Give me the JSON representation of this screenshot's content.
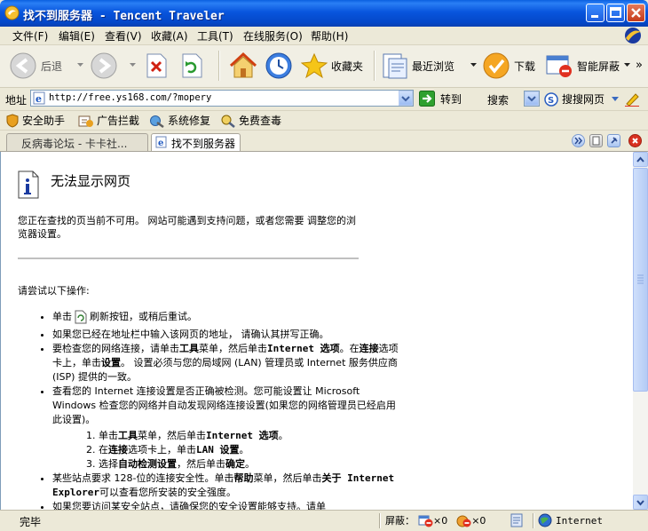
{
  "window": {
    "title": "找不到服务器 - Tencent Traveler"
  },
  "menu": [
    "文件(F)",
    "编辑(E)",
    "查看(V)",
    "收藏(A)",
    "工具(T)",
    "在线服务(O)",
    "帮助(H)"
  ],
  "toolbar": {
    "back": "后退",
    "favorites": "收藏夹",
    "recent": "最近浏览",
    "download": "下载",
    "smart_block": "智能屏蔽",
    "more": "»"
  },
  "address": {
    "label": "地址",
    "url": "http://free.ys168.com/?mopery",
    "go": "转到",
    "search_label": "搜索",
    "search_engine": "搜搜网页"
  },
  "links": [
    "安全助手",
    "广告拦截",
    "系统修复",
    "免费查毒"
  ],
  "tabs": [
    {
      "label": "反病毒论坛 - 卡卡社...",
      "active": false
    },
    {
      "label": "找不到服务器",
      "active": true
    }
  ],
  "page": {
    "heading": "无法显示网页",
    "desc": "您正在查找的页当前不可用。 网站可能遇到支持问题，或者您需要 调整您的浏览器设置。",
    "try_label": "请尝试以下操作:",
    "b1_pre": "单击",
    "b1_post": "刷新按钮，或稍后重试。",
    "b2": "如果您已经在地址栏中输入该网页的地址， 请确认其拼写正确。",
    "b3_a": "要检查您的网络连接，请单击",
    "b3_tools": "工具",
    "b3_b": "菜单，然后单击",
    "b3_io": "Internet 选项",
    "b3_c": "。在",
    "b3_conn": "连接",
    "b3_d": "选项卡上，单击",
    "b3_settings": "设置",
    "b3_e": "。 设置必须与您的局域网 (LAN) 管理员或 Internet 服务供应商 (ISP) 提供的一致。",
    "b4": "查看您的 Internet 连接设置是否正确被检测。您可能设置让 Microsoft Windows 检查您的网络并自动发现网络连接设置(如果您的网络管理员已经启用此设置)。",
    "s1_a": "单击",
    "s1_tools": "工具",
    "s1_b": "菜单，然后单击",
    "s1_io": "Internet 选项",
    "s1_c": "。",
    "s2_a": "在",
    "s2_conn": "连接",
    "s2_b": "选项卡上，单击",
    "s2_lan": "LAN 设置",
    "s2_c": "。",
    "s3_a": "选择",
    "s3_auto": "自动检测设置",
    "s3_b": "，然后单击",
    "s3_ok": "确定",
    "s3_c": "。",
    "b5_a": "某些站点要求 128-位的连接安全性。单击",
    "b5_help": "帮助",
    "b5_b": "菜单，然后单击",
    "b5_about": "关于 Internet Explorer",
    "b5_c": "可以查看您所安装的安全强度。",
    "b6": "如果您要访问某安全站点，请确保您的安全设置能够支持。请单"
  },
  "status": {
    "text": "完毕",
    "block_label": "屏蔽：",
    "popup_count": "×0",
    "ad_count": "×0",
    "zone": "Internet"
  },
  "colors": {
    "titlebar": "#0855dd",
    "tab_active": "#ffffff",
    "close": "#c53a1a"
  }
}
